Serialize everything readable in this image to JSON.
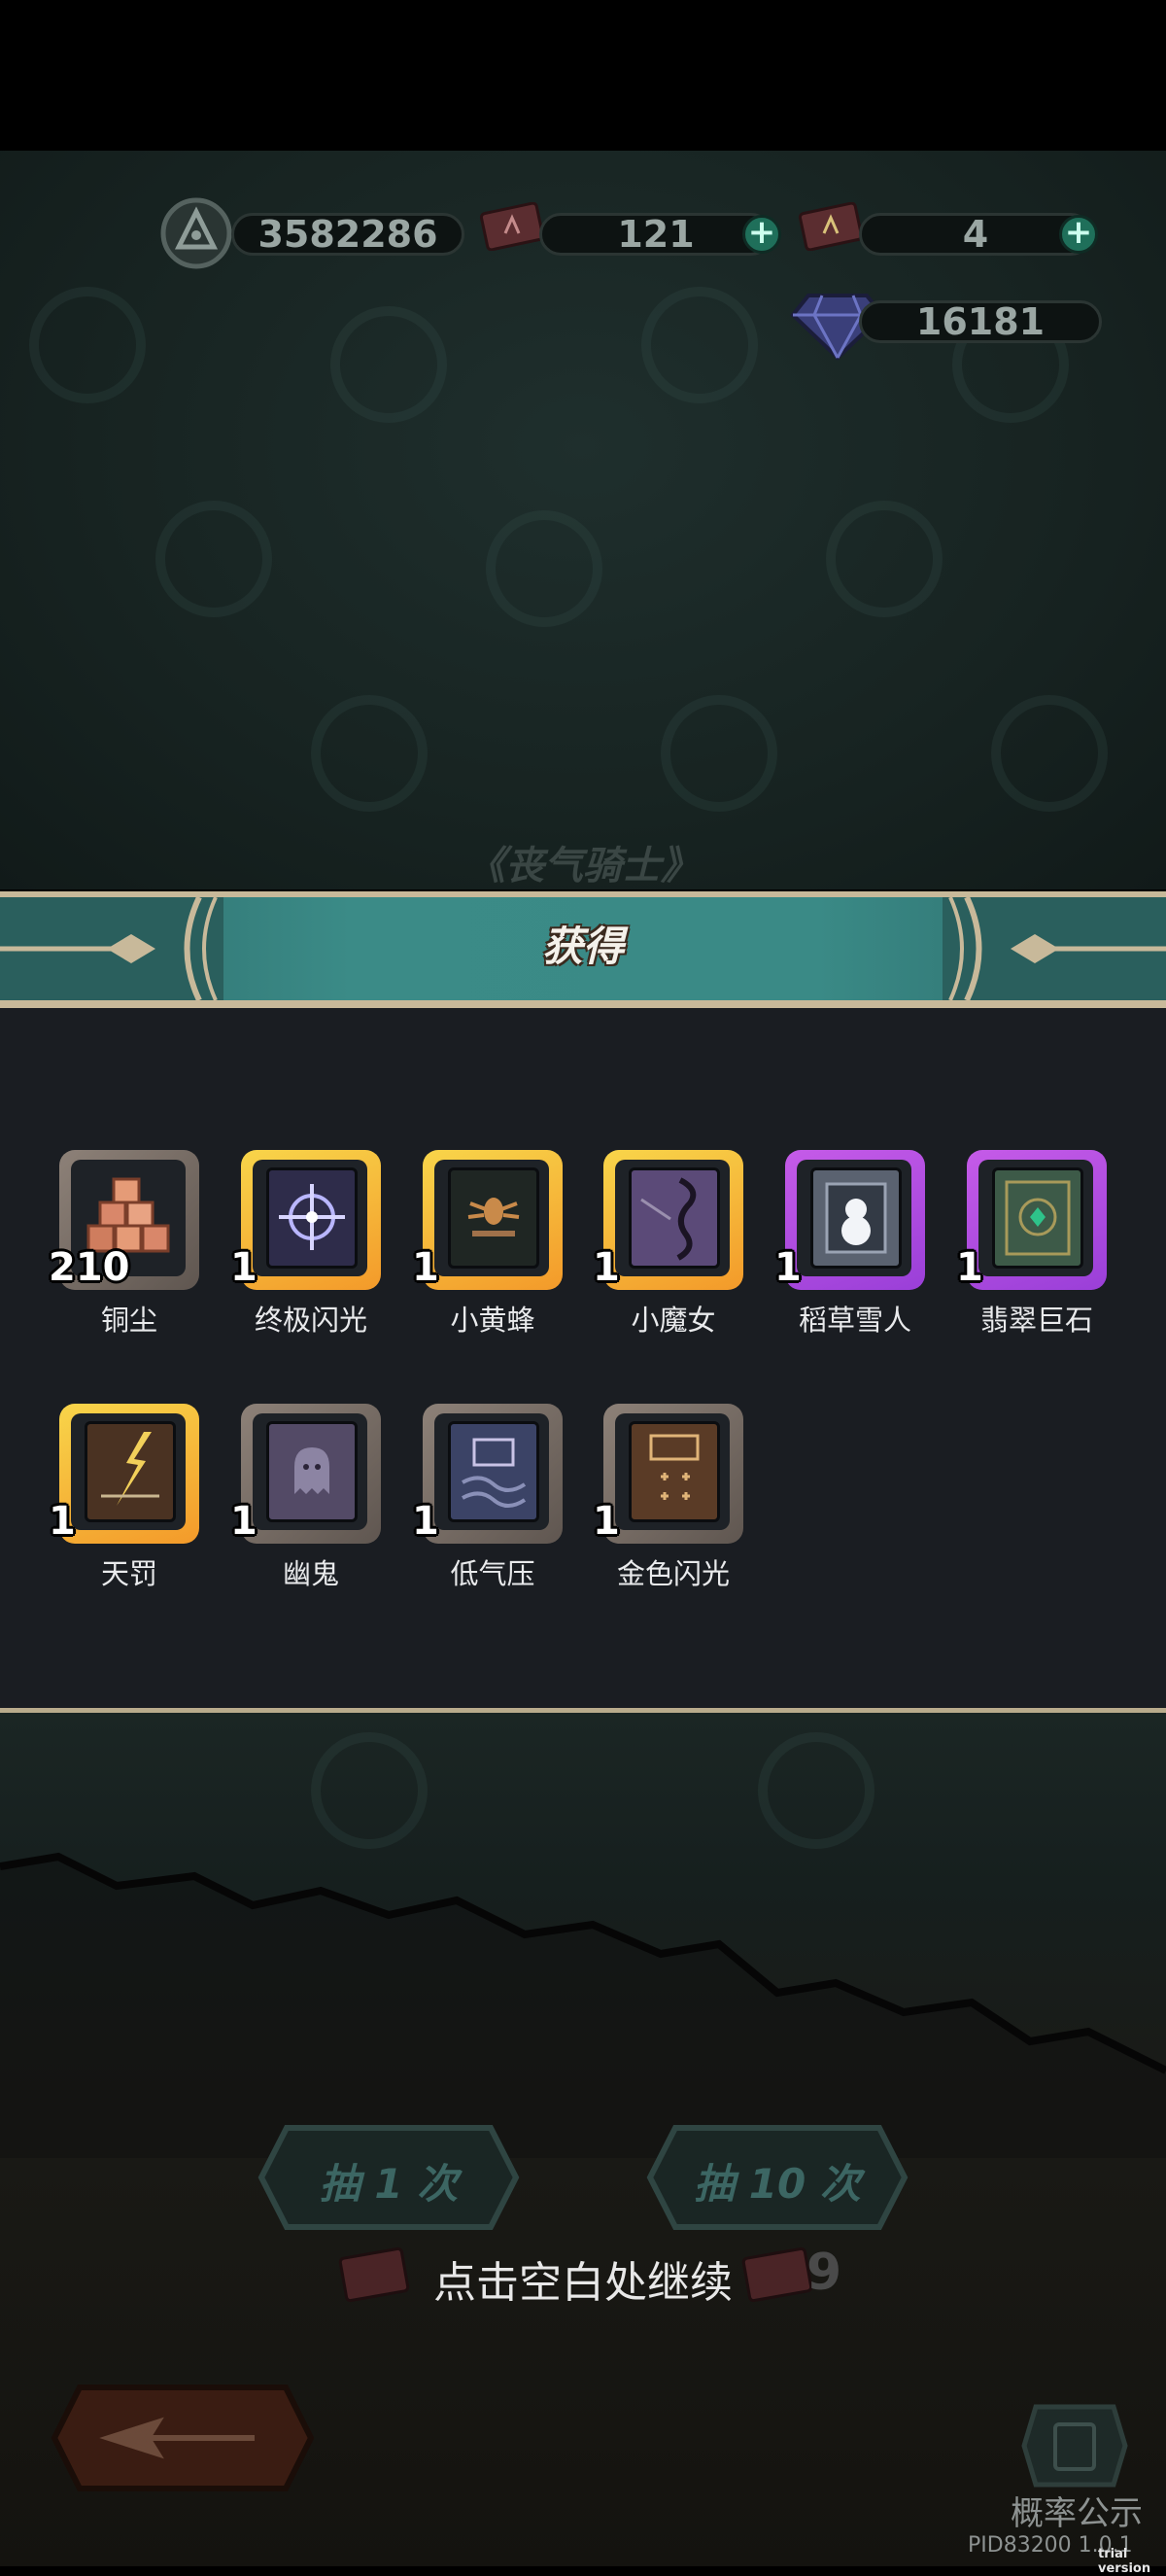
{
  "header": {
    "currencies": [
      {
        "icon": "soul-emblem-icon",
        "value": "3582286"
      },
      {
        "icon": "ticket-icon",
        "value": "121"
      },
      {
        "icon": "golden-ticket-icon",
        "value": "4"
      },
      {
        "icon": "gem-icon",
        "value": "16181"
      }
    ]
  },
  "pool_title": "《丧气骑士》",
  "reward_panel": {
    "title": "获得",
    "items": [
      {
        "name": "铜尘",
        "qty": "210",
        "rarity": "common",
        "icon": "copper-dust-icon"
      },
      {
        "name": "终极闪光",
        "qty": "1",
        "rarity": "legendary",
        "icon": "ultimate-flash-book-icon"
      },
      {
        "name": "小黄蜂",
        "qty": "1",
        "rarity": "legendary",
        "icon": "little-hornet-book-icon"
      },
      {
        "name": "小魔女",
        "qty": "1",
        "rarity": "legendary",
        "icon": "little-witch-book-icon"
      },
      {
        "name": "稻草雪人",
        "qty": "1",
        "rarity": "epic",
        "icon": "straw-snowman-book-icon"
      },
      {
        "name": "翡翠巨石",
        "qty": "1",
        "rarity": "epic",
        "icon": "emerald-boulder-book-icon"
      },
      {
        "name": "天罚",
        "qty": "1",
        "rarity": "legendary",
        "icon": "divine-punishment-book-icon"
      },
      {
        "name": "幽鬼",
        "qty": "1",
        "rarity": "common",
        "icon": "ghost-book-icon"
      },
      {
        "name": "低气压",
        "qty": "1",
        "rarity": "common",
        "icon": "low-pressure-book-icon"
      },
      {
        "name": "金色闪光",
        "qty": "1",
        "rarity": "common",
        "icon": "golden-flash-book-icon"
      }
    ]
  },
  "actions": {
    "draw_one": "抽 1 次",
    "draw_ten": "抽 10 次",
    "continue_hint": "点击空白处继续",
    "ticket_count": "9"
  },
  "footer": {
    "probability_label": "概率公示",
    "pid": "PID83200 1.0.1",
    "watermark": "trial version"
  },
  "colors": {
    "legendary": "#f5b62a",
    "epic": "#b04ce6",
    "common": "#7a6f66",
    "banner": "#3a8a86"
  }
}
